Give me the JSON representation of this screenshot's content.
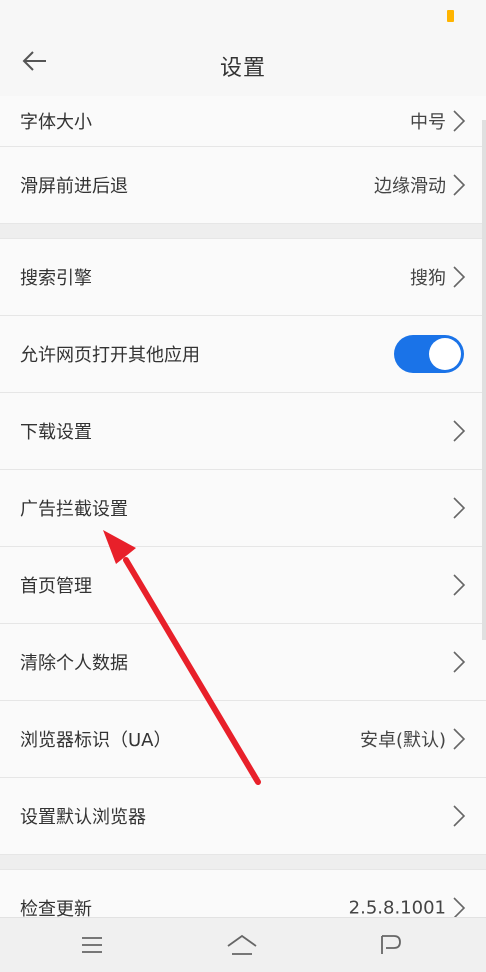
{
  "header": {
    "title": "设置",
    "back_icon": "arrow-left-icon"
  },
  "groups": [
    {
      "rows": [
        {
          "label": "字体大小",
          "value": "中号",
          "type": "nav"
        },
        {
          "label": "滑屏前进后退",
          "value": "边缘滑动",
          "type": "nav"
        }
      ]
    },
    {
      "rows": [
        {
          "label": "搜索引擎",
          "value": "搜狗",
          "type": "nav"
        },
        {
          "label": "允许网页打开其他应用",
          "type": "toggle",
          "on": true
        },
        {
          "label": "下载设置",
          "value": "",
          "type": "nav"
        },
        {
          "label": "广告拦截设置",
          "value": "",
          "type": "nav"
        },
        {
          "label": "首页管理",
          "value": "",
          "type": "nav"
        },
        {
          "label": "清除个人数据",
          "value": "",
          "type": "nav"
        },
        {
          "label": "浏览器标识（UA）",
          "value": "安卓(默认)",
          "type": "nav"
        },
        {
          "label": "设置默认浏览器",
          "value": "",
          "type": "nav"
        }
      ]
    },
    {
      "rows": [
        {
          "label": "检查更新",
          "value": "2.5.8.1001",
          "type": "nav"
        }
      ]
    }
  ],
  "colors": {
    "accent": "#1a73e8",
    "annotation_arrow": "#e8202a",
    "battery": "#ffb400"
  },
  "navbar": {
    "icons": [
      "menu-icon",
      "home-icon",
      "back-icon"
    ]
  }
}
